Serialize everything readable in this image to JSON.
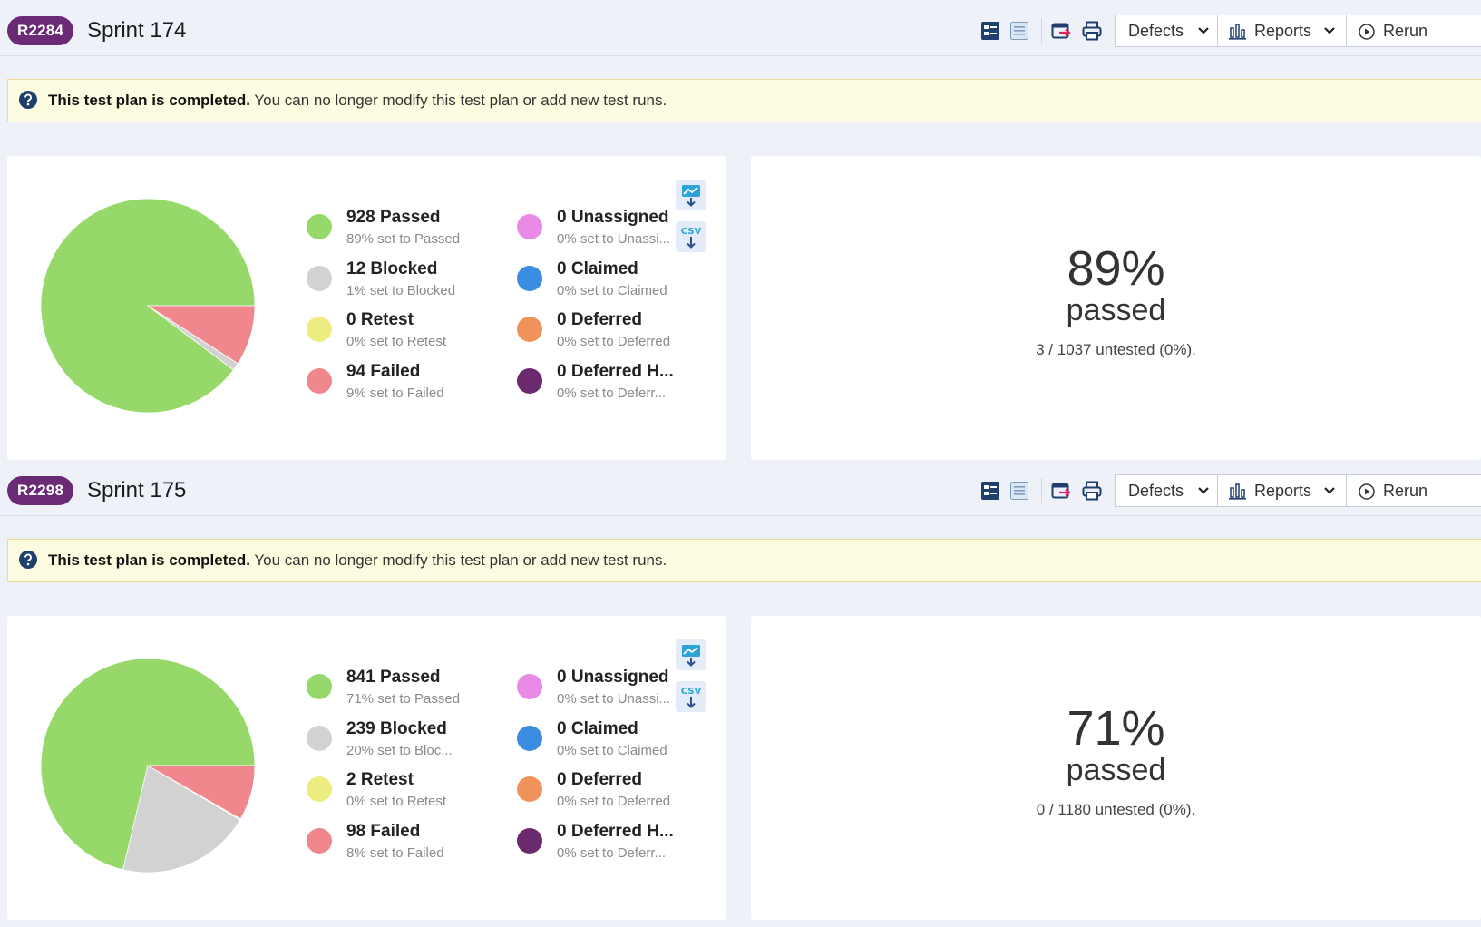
{
  "toolbar": {
    "defects_label": "Defects",
    "reports_label": "Reports",
    "rerun_label": "Rerun"
  },
  "notice": {
    "bold": "This test plan is completed.",
    "text": " You can no longer modify this test plan or add new test runs."
  },
  "download_csv_label": "CSV",
  "status_colors": {
    "passed": "#96d86a",
    "blocked": "#d2d2d2",
    "retest": "#ecec80",
    "failed": "#f0878c",
    "unassigned": "#e88ae6",
    "claimed": "#3a8de0",
    "deferred": "#f0935a",
    "deferred_h": "#6b2a6e"
  },
  "plans": [
    {
      "id": "R2284",
      "title": "Sprint 174",
      "percent": "89%",
      "percent_label": "passed",
      "untested": "3 / 1037 untested (0%).",
      "legend": [
        {
          "key": "passed",
          "name": "928 Passed",
          "sub": "89% set to Passed"
        },
        {
          "key": "blocked",
          "name": "12 Blocked",
          "sub": "1% set to Blocked"
        },
        {
          "key": "retest",
          "name": "0 Retest",
          "sub": "0% set to Retest"
        },
        {
          "key": "failed",
          "name": "94 Failed",
          "sub": "9% set to Failed"
        },
        {
          "key": "unassigned",
          "name": "0 Unassigned",
          "sub": "0% set to Unassi..."
        },
        {
          "key": "claimed",
          "name": "0 Claimed",
          "sub": "0% set to Claimed"
        },
        {
          "key": "deferred",
          "name": "0 Deferred",
          "sub": "0% set to Deferred"
        },
        {
          "key": "deferred_h",
          "name": "0 Deferred H...",
          "sub": "0% set to Deferr..."
        }
      ],
      "chart_data": {
        "type": "pie",
        "slices": [
          {
            "label": "Passed",
            "value": 928
          },
          {
            "label": "Blocked",
            "value": 12
          },
          {
            "label": "Retest",
            "value": 0
          },
          {
            "label": "Failed",
            "value": 94
          }
        ]
      }
    },
    {
      "id": "R2298",
      "title": "Sprint 175",
      "percent": "71%",
      "percent_label": "passed",
      "untested": "0 / 1180 untested (0%).",
      "legend": [
        {
          "key": "passed",
          "name": "841 Passed",
          "sub": "71% set to Passed"
        },
        {
          "key": "blocked",
          "name": "239 Blocked",
          "sub": "20% set to Bloc..."
        },
        {
          "key": "retest",
          "name": "2 Retest",
          "sub": "0% set to Retest"
        },
        {
          "key": "failed",
          "name": "98 Failed",
          "sub": "8% set to Failed"
        },
        {
          "key": "unassigned",
          "name": "0 Unassigned",
          "sub": "0% set to Unassi..."
        },
        {
          "key": "claimed",
          "name": "0 Claimed",
          "sub": "0% set to Claimed"
        },
        {
          "key": "deferred",
          "name": "0 Deferred",
          "sub": "0% set to Deferred"
        },
        {
          "key": "deferred_h",
          "name": "0 Deferred H...",
          "sub": "0% set to Deferr..."
        }
      ],
      "chart_data": {
        "type": "pie",
        "slices": [
          {
            "label": "Passed",
            "value": 841
          },
          {
            "label": "Blocked",
            "value": 239
          },
          {
            "label": "Retest",
            "value": 2
          },
          {
            "label": "Failed",
            "value": 98
          }
        ]
      }
    }
  ]
}
